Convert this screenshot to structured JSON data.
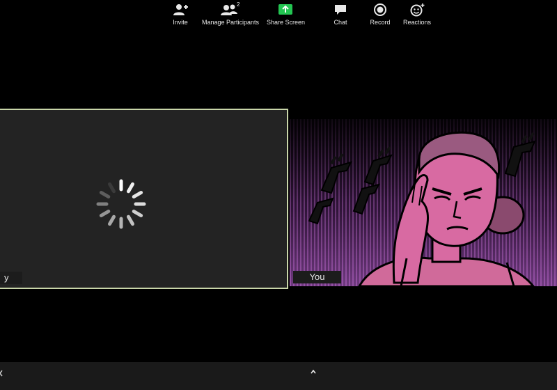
{
  "participants": {
    "left": {
      "name": "y",
      "state": "loading"
    },
    "right": {
      "name": "You"
    }
  },
  "toolbar": {
    "invite": "Invite",
    "manage_participants": "Manage Participants",
    "participant_count": "2",
    "share_screen": "Share Screen",
    "chat": "Chat",
    "record": "Record",
    "reactions": "Reactions"
  },
  "colors": {
    "active_border": "#c9d6a9",
    "share_green": "#23c552",
    "magenta_bg": "#6f3a7f"
  },
  "icons": [
    "spinner-icon",
    "add-user-icon",
    "participants-icon",
    "share-screen-icon",
    "caret-up-icon",
    "chat-icon",
    "record-icon",
    "reactions-icon"
  ]
}
